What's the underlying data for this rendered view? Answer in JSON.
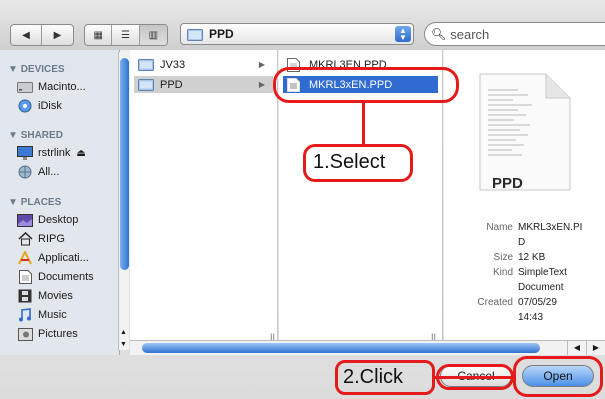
{
  "toolbar": {
    "back_icon": "back-arrow-icon",
    "forward_icon": "forward-arrow-icon",
    "view_buttons": [
      "icon-view-icon",
      "list-view-icon",
      "column-view-icon"
    ],
    "path_popup": {
      "label": "PPD"
    },
    "search": {
      "placeholder": "search"
    }
  },
  "sidebar": {
    "sections": [
      {
        "header": "DEVICES",
        "items": [
          {
            "label": "Macinto...",
            "icon": "hard-drive-icon"
          },
          {
            "label": "iDisk",
            "icon": "idisk-icon"
          }
        ]
      },
      {
        "header": "SHARED",
        "items": [
          {
            "label": "rstrlink",
            "icon": "display-icon",
            "eject": "⏏"
          },
          {
            "label": "All...",
            "icon": "network-icon"
          }
        ]
      },
      {
        "header": "PLACES",
        "items": [
          {
            "label": "Desktop",
            "icon": "desktop-icon"
          },
          {
            "label": "RIPG",
            "icon": "home-icon"
          },
          {
            "label": "Applicati...",
            "icon": "applications-icon"
          },
          {
            "label": "Documents",
            "icon": "documents-icon"
          },
          {
            "label": "Movies",
            "icon": "movies-icon"
          },
          {
            "label": "Music",
            "icon": "music-icon"
          },
          {
            "label": "Pictures",
            "icon": "pictures-icon"
          }
        ]
      }
    ]
  },
  "columns": {
    "col1": [
      {
        "label": "JV33",
        "icon": "folder-icon"
      },
      {
        "label": "PPD",
        "icon": "folder-icon",
        "state": "highlighted"
      }
    ],
    "col2": [
      {
        "label": "MKRL3EN.PPD",
        "icon": "document-icon"
      },
      {
        "label": "MKRL3xEN.PPD",
        "icon": "document-icon",
        "state": "selected"
      }
    ]
  },
  "preview": {
    "doc_label": "PPD",
    "info": [
      {
        "key": "Name",
        "value": [
          "MKRL3xEN.PI",
          "D"
        ]
      },
      {
        "key": "Size",
        "value": [
          "12 KB"
        ]
      },
      {
        "key": "Kind",
        "value": [
          "SimpleText",
          "Document"
        ]
      },
      {
        "key": "Created",
        "value": [
          "07/05/29",
          "14:43"
        ]
      }
    ]
  },
  "buttons": {
    "cancel": "Cancel",
    "open": "Open"
  },
  "callouts": {
    "select": "1.Select",
    "click": "2.Click"
  },
  "colors": {
    "accent": "#2f6bd1",
    "annotation": "#e51a1a"
  }
}
